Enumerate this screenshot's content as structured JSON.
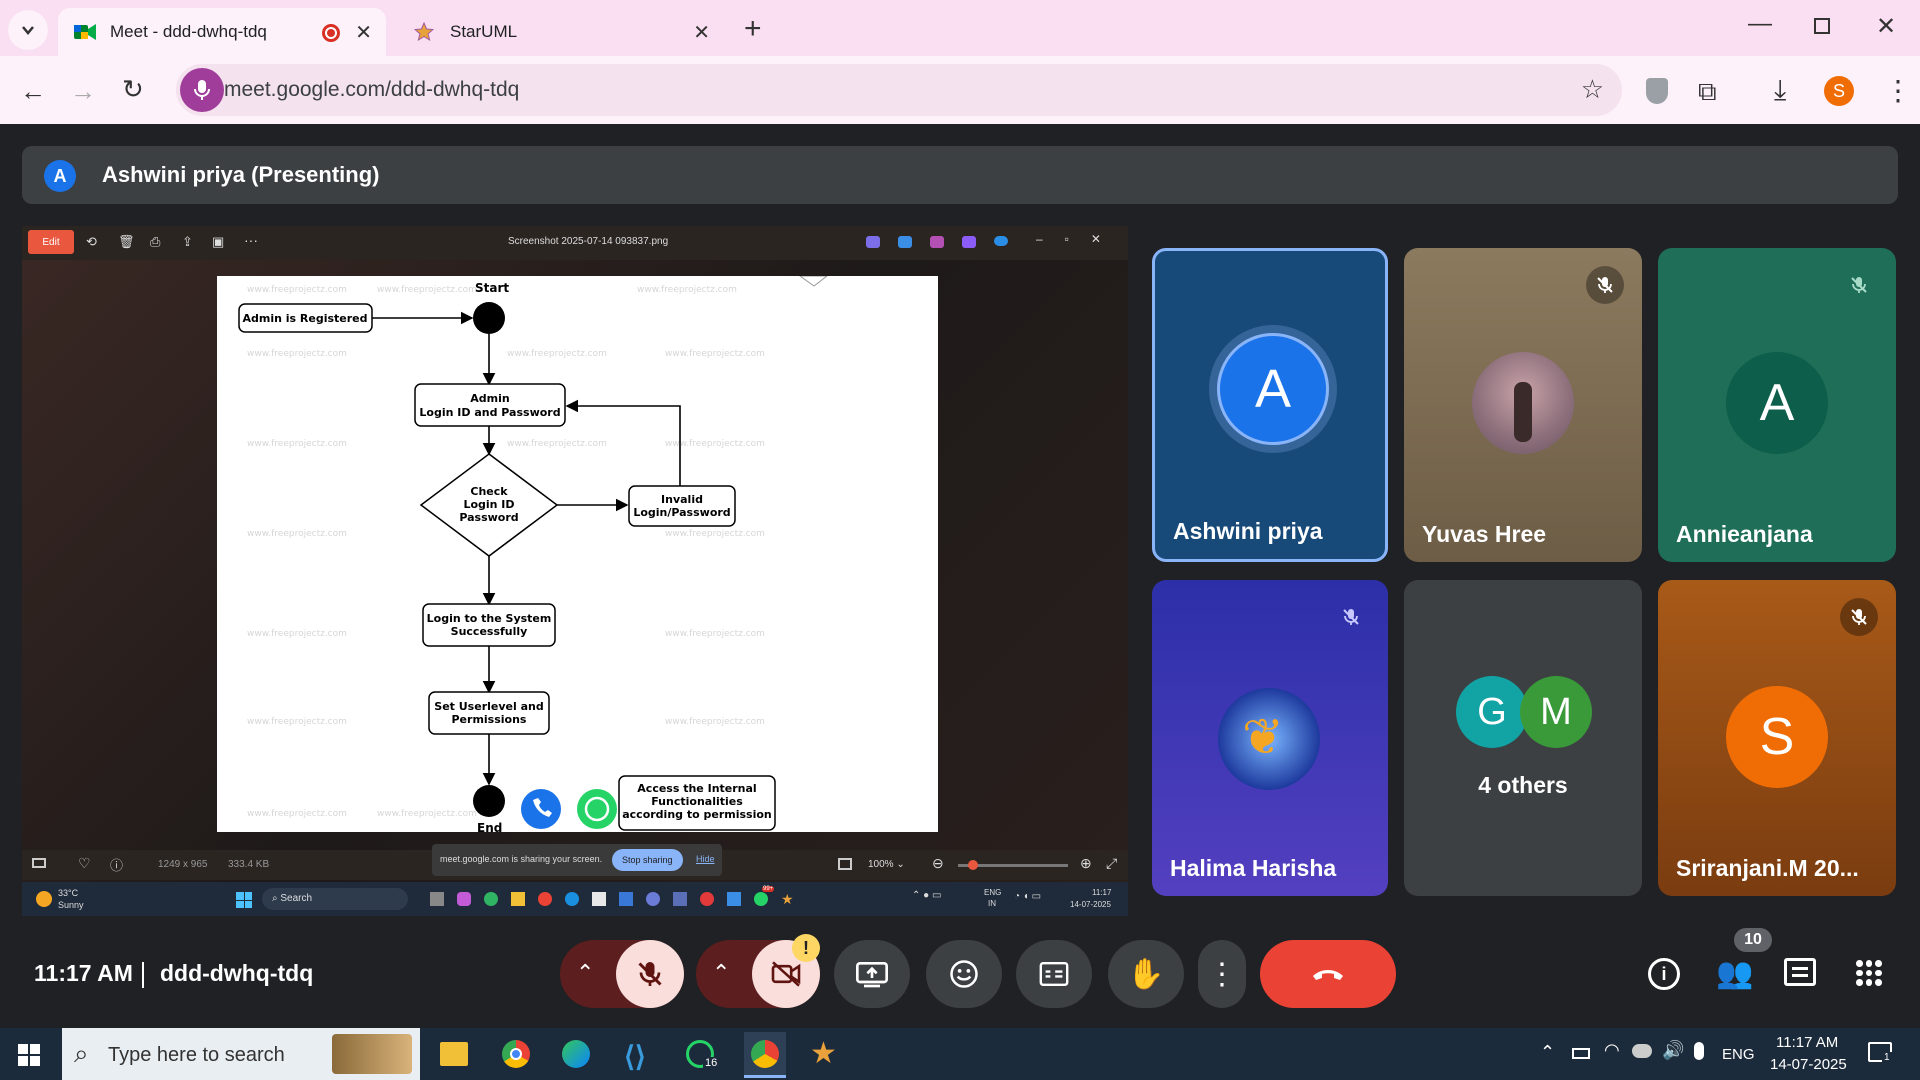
{
  "browser": {
    "tabs": [
      {
        "label": "Meet - ddd-dwhq-tdq",
        "icon": "google-meet-icon",
        "recording": true
      },
      {
        "label": "StarUML",
        "icon": "staruml-icon"
      }
    ],
    "url": "meet.google.com/ddd-dwhq-tdq",
    "profile_initial": "S"
  },
  "presenter": {
    "initial": "A",
    "label": "Ashwini priya (Presenting)"
  },
  "shared_screen": {
    "viewer": {
      "edit_label": "Edit",
      "filename": "Screenshot 2025-07-14 093837.png",
      "dimensions": "1249 x 965",
      "filesize": "333.4 KB",
      "zoom": "100%"
    },
    "share_bar": {
      "text": "meet.google.com is sharing your screen.",
      "stop_label": "Stop sharing",
      "hide_label": "Hide"
    },
    "taskbar": {
      "weather_temp": "33°C",
      "weather_desc": "Sunny",
      "search_label": "Search",
      "lang": "ENG",
      "region": "IN",
      "time": "11:17",
      "date": "14-07-2025",
      "badge": "99+"
    },
    "diagram": {
      "watermark": "www.freeprojectz.com",
      "start_label": "Start",
      "end_label": "End",
      "nodes": {
        "admin_registered": "Admin is Registered",
        "login_line1": "Admin",
        "login_line2": "Login ID and Password",
        "check_line1": "Check",
        "check_line2": "Login ID",
        "check_line3": "Password",
        "invalid_line1": "Invalid",
        "invalid_line2": "Login/Password",
        "success_line1": "Login to the System",
        "success_line2": "Successfully",
        "userlevel_line1": "Set Userlevel and",
        "userlevel_line2": "Permissions",
        "access_line1": "Access the Internal",
        "access_line2": "Functionalities",
        "access_line3": "according to permission"
      }
    }
  },
  "participants": [
    {
      "name": "Ashwini priya",
      "initial": "A",
      "muted": false,
      "color": "#1a73e8",
      "speaking": true
    },
    {
      "name": "Yuvas Hree",
      "muted": true,
      "avatar": "photo"
    },
    {
      "name": "Annieanjana",
      "initial": "A",
      "muted": true,
      "color": "#0d5e4a"
    },
    {
      "name": "Halima Harisha",
      "muted": true,
      "avatar": "butterfly"
    },
    {
      "others_label": "4 others",
      "initials": [
        "G",
        "M"
      ],
      "colors": [
        "#12a4a4",
        "#3a9a3a"
      ]
    },
    {
      "name": "Sriranjani.M 20...",
      "initial": "S",
      "muted": true,
      "color": "#f06d05"
    }
  ],
  "footer": {
    "time": "11:17 AM",
    "meeting_code": "ddd-dwhq-tdq",
    "people_count": "10",
    "warning": "!"
  },
  "windows": {
    "search_placeholder": "Type here to search",
    "time": "11:17 AM",
    "date": "14-07-2025",
    "lang": "ENG",
    "whatsapp_badge": "16",
    "notif_count": "1"
  }
}
